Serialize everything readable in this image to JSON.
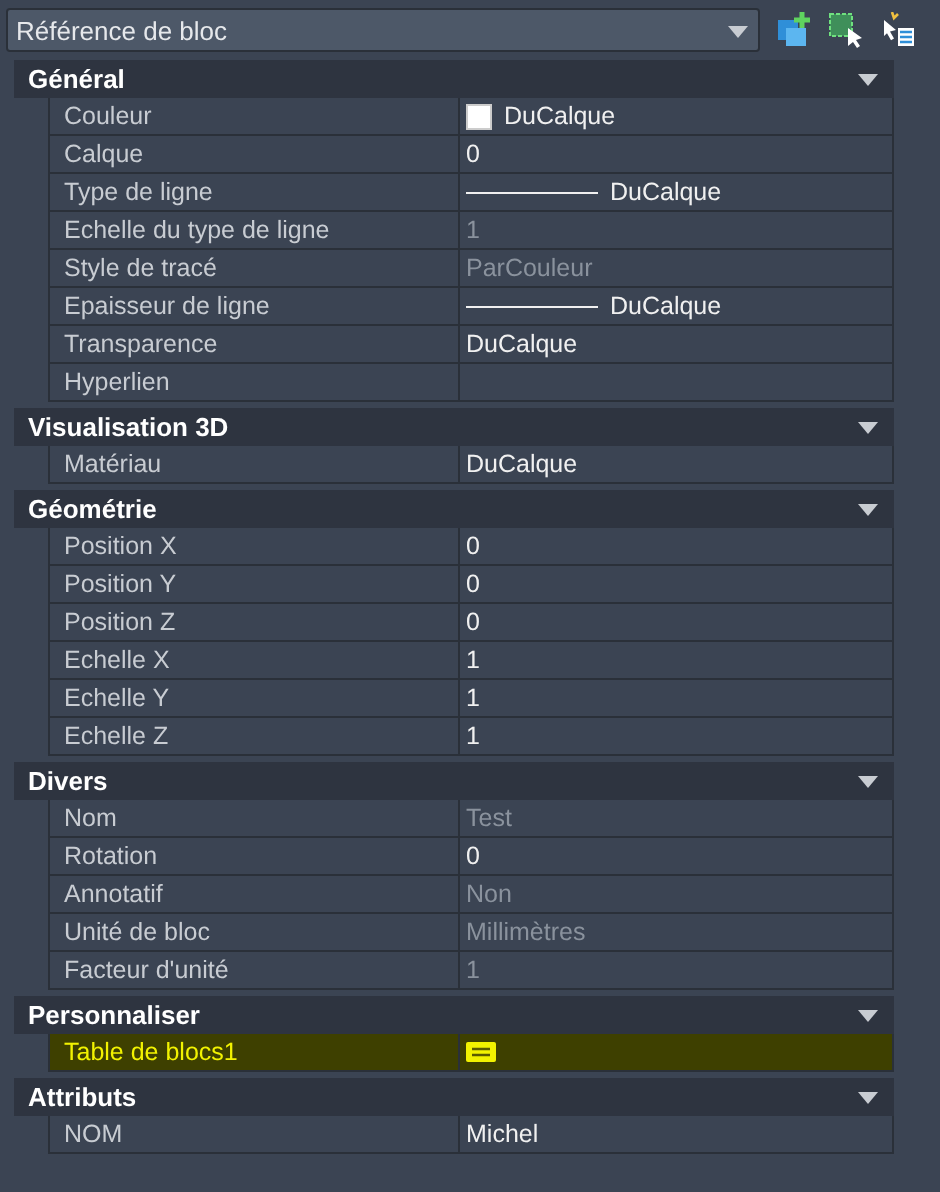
{
  "selector": {
    "value": "Référence de bloc"
  },
  "sections": [
    {
      "title": "Général",
      "expanded": true,
      "rows": [
        {
          "label": "Couleur",
          "kind": "color",
          "value": "DuCalque",
          "disabled": false,
          "color": "#ffffff"
        },
        {
          "label": "Calque",
          "kind": "text",
          "value": "0",
          "disabled": false
        },
        {
          "label": "Type de ligne",
          "kind": "linetype",
          "value": "DuCalque",
          "disabled": false
        },
        {
          "label": "Echelle du type de ligne",
          "kind": "text",
          "value": "1",
          "disabled": true
        },
        {
          "label": "Style de tracé",
          "kind": "text",
          "value": "ParCouleur",
          "disabled": true
        },
        {
          "label": "Epaisseur de ligne",
          "kind": "linetype",
          "value": "DuCalque",
          "disabled": false
        },
        {
          "label": "Transparence",
          "kind": "text",
          "value": "DuCalque",
          "disabled": false
        },
        {
          "label": "Hyperlien",
          "kind": "empty"
        }
      ]
    },
    {
      "title": "Visualisation 3D",
      "expanded": true,
      "rows": [
        {
          "label": "Matériau",
          "kind": "text",
          "value": "DuCalque",
          "disabled": false
        }
      ]
    },
    {
      "title": "Géométrie",
      "expanded": true,
      "rows": [
        {
          "label": "Position X",
          "kind": "text",
          "value": "0",
          "disabled": false
        },
        {
          "label": "Position Y",
          "kind": "text",
          "value": "0",
          "disabled": false
        },
        {
          "label": "Position Z",
          "kind": "text",
          "value": "0",
          "disabled": false
        },
        {
          "label": "Echelle X",
          "kind": "text",
          "value": "1",
          "disabled": false
        },
        {
          "label": "Echelle Y",
          "kind": "text",
          "value": "1",
          "disabled": false
        },
        {
          "label": "Echelle Z",
          "kind": "text",
          "value": "1",
          "disabled": false
        }
      ]
    },
    {
      "title": "Divers",
      "expanded": true,
      "rows": [
        {
          "label": "Nom",
          "kind": "text",
          "value": "Test",
          "disabled": true
        },
        {
          "label": "Rotation",
          "kind": "text",
          "value": "0",
          "disabled": false
        },
        {
          "label": "Annotatif",
          "kind": "text",
          "value": "Non",
          "disabled": true
        },
        {
          "label": "Unité de bloc",
          "kind": "text",
          "value": "Millimètres",
          "disabled": true
        },
        {
          "label": "Facteur d'unité",
          "kind": "text",
          "value": "1",
          "disabled": true
        }
      ]
    },
    {
      "title": "Personnaliser",
      "expanded": true,
      "rows": [
        {
          "label": "Table de blocs1",
          "kind": "button",
          "highlighted": true
        }
      ]
    },
    {
      "title": "Attributs",
      "expanded": true,
      "rows": [
        {
          "label": "NOM",
          "kind": "text",
          "value": "Michel",
          "disabled": false
        }
      ]
    }
  ]
}
